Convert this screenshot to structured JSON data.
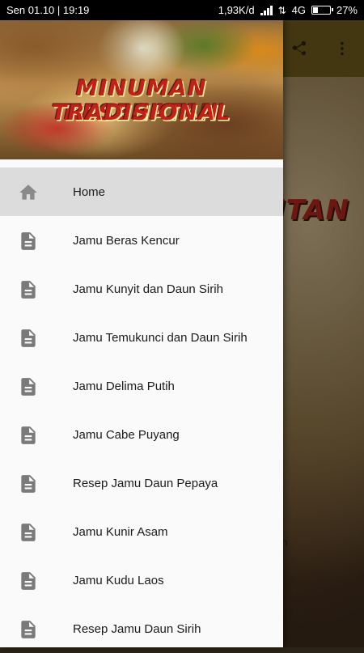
{
  "status_bar": {
    "carrier_time": "Sen 01.10 | 19:19",
    "speed": "1,93K/d",
    "network": "4G",
    "battery": "27%",
    "battery_level": 0.27
  },
  "app_bar": {
    "share_icon": "share-icon",
    "overflow_icon": "more-vert-icon"
  },
  "background": {
    "title_fragment": "ITAN",
    "text_fragment": "n"
  },
  "drawer": {
    "header": {
      "title_line1": "MINUMAN KESEHATAN",
      "title_line2": "TRADISIONAL"
    },
    "items": [
      {
        "label": "Home",
        "icon": "home-icon",
        "active": true
      },
      {
        "label": "Jamu Beras Kencur",
        "icon": "document-icon",
        "active": false
      },
      {
        "label": "Jamu Kunyit dan Daun Sirih",
        "icon": "document-icon",
        "active": false
      },
      {
        "label": "Jamu Temukunci dan Daun Sirih",
        "icon": "document-icon",
        "active": false
      },
      {
        "label": "Jamu Delima Putih",
        "icon": "document-icon",
        "active": false
      },
      {
        "label": "Jamu Cabe Puyang",
        "icon": "document-icon",
        "active": false
      },
      {
        "label": "Resep Jamu Daun Pepaya",
        "icon": "document-icon",
        "active": false
      },
      {
        "label": "Jamu Kunir Asam",
        "icon": "document-icon",
        "active": false
      },
      {
        "label": "Jamu Kudu Laos",
        "icon": "document-icon",
        "active": false
      },
      {
        "label": "Resep Jamu Daun Sirih",
        "icon": "document-icon",
        "active": false
      }
    ]
  },
  "colors": {
    "accent_red": "#c2201a",
    "app_bar": "#6b5a1c",
    "active_item": "#dcdcdc",
    "icon_gray": "#7a7a7a"
  }
}
